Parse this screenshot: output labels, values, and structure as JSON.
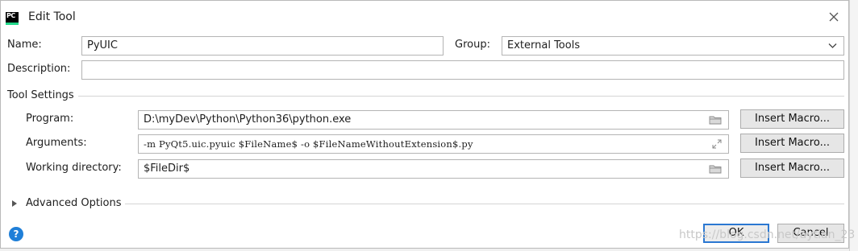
{
  "window": {
    "title": "Edit Tool",
    "app_icon_text": "PC"
  },
  "form": {
    "name_label": "Name:",
    "name_value": "PyUIC",
    "group_label": "Group:",
    "group_value": "External Tools",
    "description_label": "Description:",
    "description_value": ""
  },
  "tool_settings": {
    "title": "Tool Settings",
    "program_label": "Program:",
    "program_value": "D:\\myDev\\Python\\Python36\\python.exe",
    "arguments_label": "Arguments:",
    "arguments_value": "-m PyQt5.uic.pyuic  $FileName$ -o $FileNameWithoutExtension$.py",
    "workdir_label": "Working directory:",
    "workdir_value": "$FileDir$",
    "insert_macro_label": "Insert Macro..."
  },
  "advanced": {
    "label": "Advanced Options"
  },
  "footer": {
    "ok_label": "OK",
    "cancel_label": "Cancel",
    "help_icon_text": "?"
  },
  "watermark": "https://blog.csdn.net/aytian_23",
  "colors": {
    "accent": "#2b78d2",
    "help": "#1f7fd8",
    "logo_green": "#21d789"
  }
}
